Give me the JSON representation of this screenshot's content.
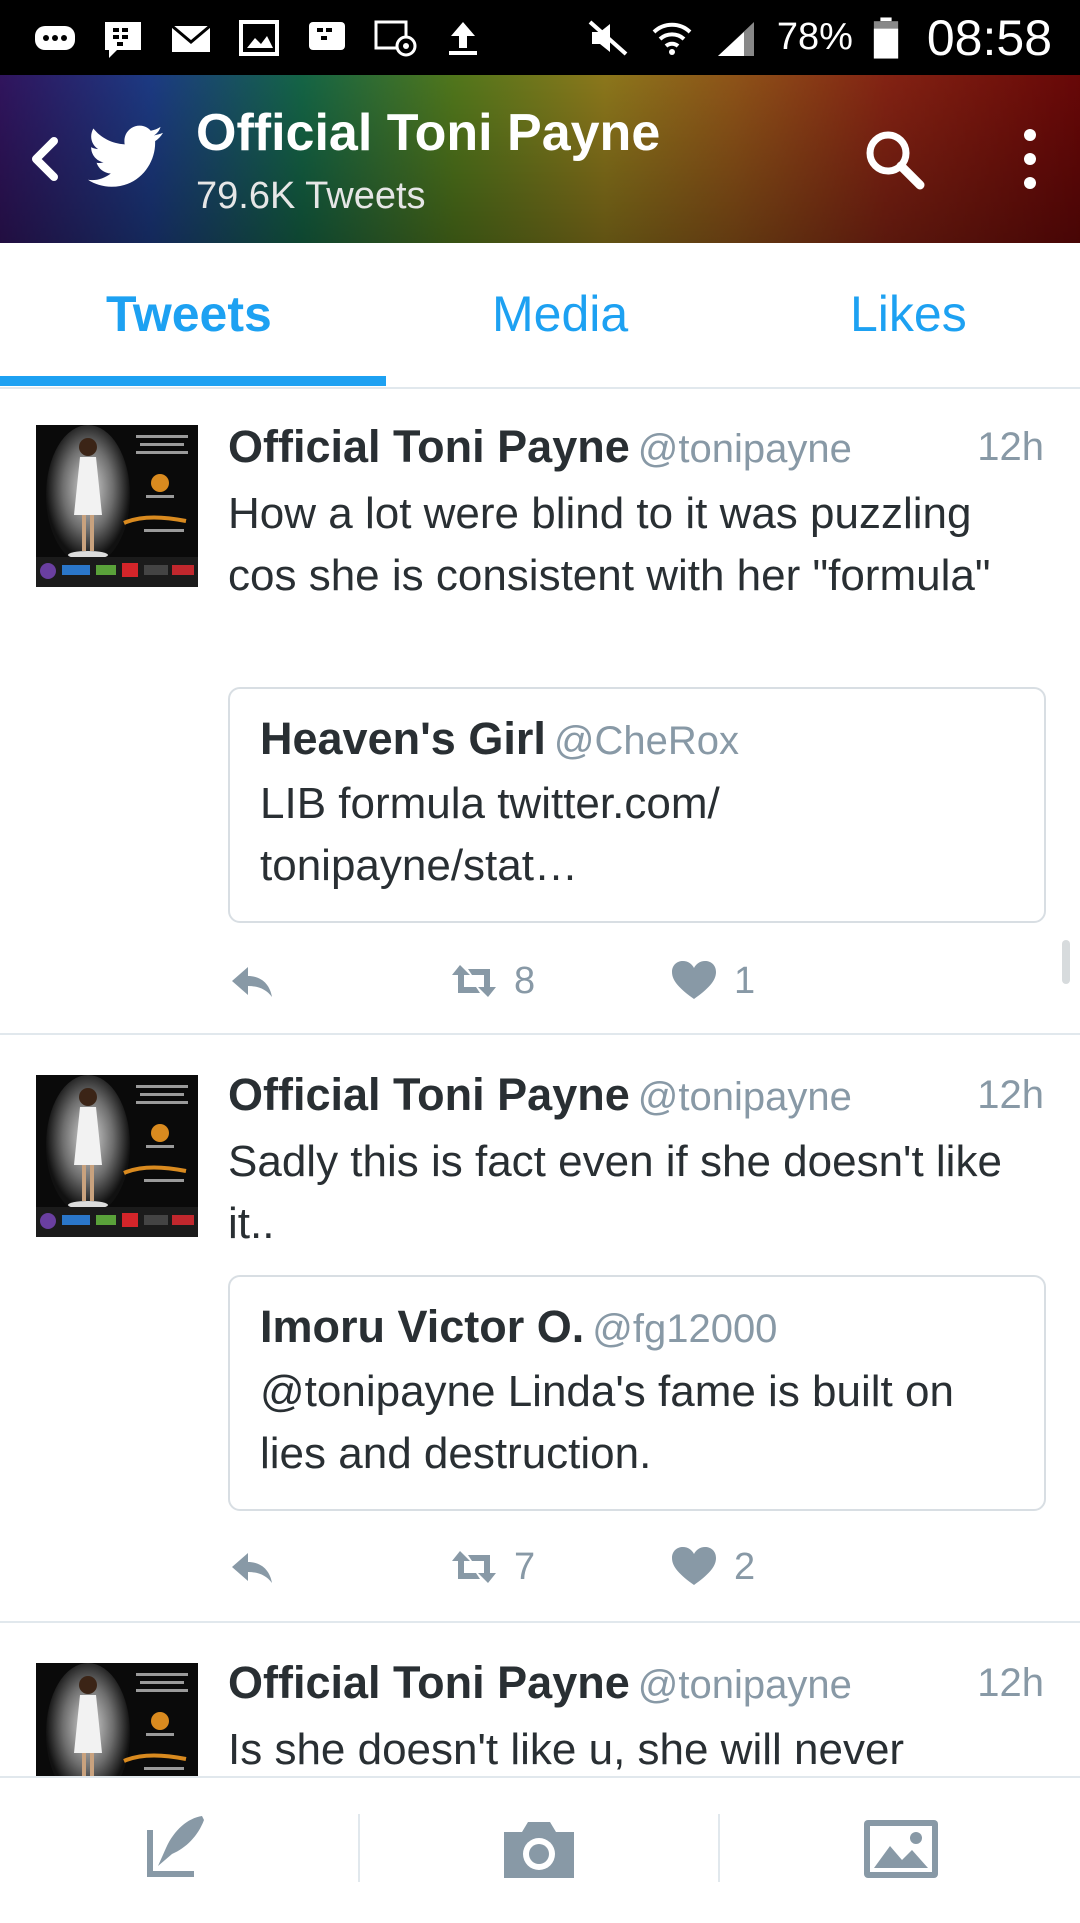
{
  "status_bar": {
    "battery_percent": "78%",
    "time": "08:58"
  },
  "header": {
    "title": "Official Toni Payne",
    "tweet_count": "79.6K Tweets"
  },
  "tabs": [
    {
      "label": "Tweets",
      "active": true
    },
    {
      "label": "Media",
      "active": false
    },
    {
      "label": "Likes",
      "active": false
    }
  ],
  "tweets": [
    {
      "name": "Official Toni Payne",
      "handle": "@tonipayne",
      "time": "12h",
      "text": "How a lot were blind to it was puzzling cos she is consistent with her \"formula\"",
      "quote": {
        "name": "Heaven's Girl",
        "handle": "@CheRox",
        "text": "LIB formula  twitter.com/ tonipayne/stat…"
      },
      "retweets": "8",
      "likes": "1"
    },
    {
      "name": "Official Toni Payne",
      "handle": "@tonipayne",
      "time": "12h",
      "text": "Sadly this is fact even if she doesn't like it..",
      "quote": {
        "name": "Imoru Victor O.",
        "handle": "@fg12000",
        "text": "@tonipayne Linda's fame is built on lies and destruction."
      },
      "retweets": "7",
      "likes": "2"
    },
    {
      "name": "Official Toni Payne",
      "handle": "@tonipayne",
      "time": "12h",
      "text": "Is she doesn't like u, she will never"
    }
  ],
  "colors": {
    "accent": "#1da1f2",
    "secondary_text": "#8899a6",
    "divider": "#e1e8ed"
  },
  "icons": {
    "back": "back-arrow-icon",
    "logo": "twitter-bird-icon",
    "search": "search-icon",
    "more": "more-vertical-icon",
    "reply": "reply-icon",
    "retweet": "retweet-icon",
    "like": "heart-icon",
    "compose": "compose-icon",
    "camera": "camera-icon",
    "gallery": "gallery-icon"
  }
}
